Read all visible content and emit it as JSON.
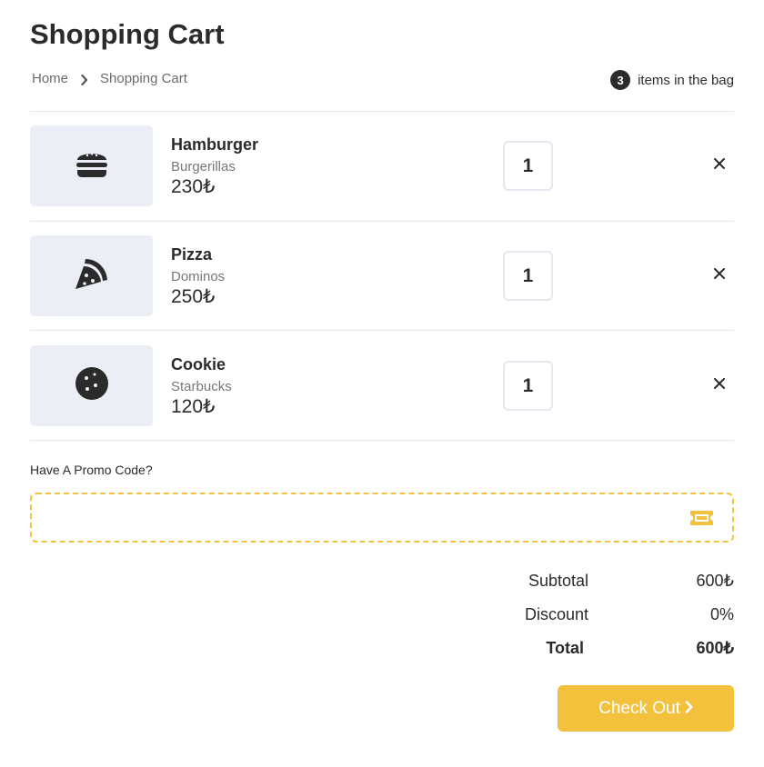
{
  "page": {
    "title": "Shopping Cart"
  },
  "breadcrumb": {
    "home": "Home",
    "current": "Shopping Cart"
  },
  "bag": {
    "count": "3",
    "label": "items in the bag"
  },
  "items": [
    {
      "name": "Hamburger",
      "brand": "Burgerillas",
      "price": "230₺",
      "quantity": "1",
      "icon": "hamburger-icon"
    },
    {
      "name": "Pizza",
      "brand": "Dominos",
      "price": "250₺",
      "quantity": "1",
      "icon": "pizza-slice-icon"
    },
    {
      "name": "Cookie",
      "brand": "Starbucks",
      "price": "120₺",
      "quantity": "1",
      "icon": "cookie-icon"
    }
  ],
  "promo": {
    "label": "Have A Promo Code?",
    "value": "",
    "icon": "ticket-icon"
  },
  "summary": {
    "subtotal_label": "Subtotal",
    "subtotal_value": "600₺",
    "discount_label": "Discount",
    "discount_value": "0%",
    "total_label": "Total",
    "total_value": "600₺"
  },
  "checkout": {
    "label": "Check Out"
  },
  "colors": {
    "accent": "#f4c13d",
    "thumb_bg": "#eceef6",
    "text": "#2b2b2b"
  }
}
